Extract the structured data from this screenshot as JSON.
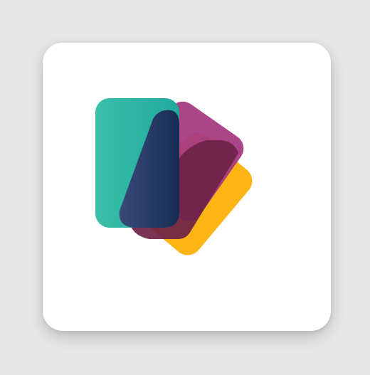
{
  "app_icon": {
    "name": "stacked-cards-app-icon",
    "cards": [
      {
        "name": "yellow-card",
        "color": "#FDB515"
      },
      {
        "name": "magenta-card",
        "color": "#A53B82"
      },
      {
        "name": "teal-card",
        "color": "#2BB3A3"
      }
    ],
    "overlap_colors": {
      "magenta_over_yellow": "#6E2246",
      "navy_over_magenta": "#1F2D5A"
    }
  }
}
